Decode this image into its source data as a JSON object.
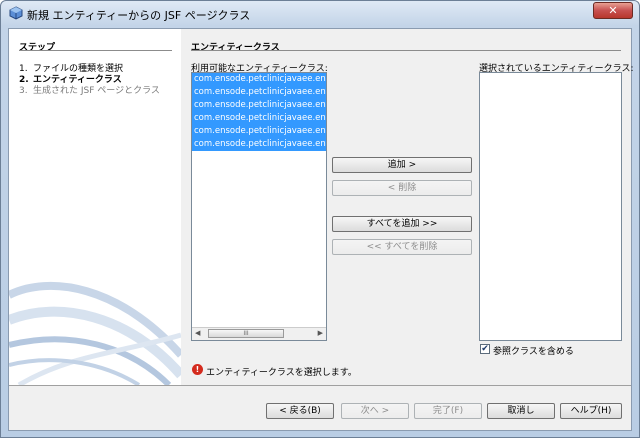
{
  "window": {
    "title": "新規 エンティティーからの JSF ページクラス",
    "close_label": "✕"
  },
  "steps": {
    "title": "ステップ",
    "items": [
      {
        "num": "1.",
        "label": "ファイルの種類を選択"
      },
      {
        "num": "2.",
        "label": "エンティティークラス"
      },
      {
        "num": "3.",
        "label": "生成された JSF ページとクラス"
      }
    ]
  },
  "panel": {
    "title": "エンティティークラス",
    "available_label": "利用可能なエンティティークラス:",
    "selected_label": "選択されているエンティティークラス:",
    "available_items": [
      "com.ensode.petclinicjavaee.ent",
      "com.ensode.petclinicjavaee.ent",
      "com.ensode.petclinicjavaee.ent",
      "com.ensode.petclinicjavaee.ent",
      "com.ensode.petclinicjavaee.ent",
      "com.ensode.petclinicjavaee.ent"
    ],
    "scroll_thumb": "III",
    "add_label": "追加 >",
    "remove_label": "< 削除",
    "add_all_label": "すべてを追加 >>",
    "remove_all_label": "<< すべてを削除",
    "include_ref_label": "参照クラスを含める",
    "include_ref_checked": true,
    "error_message": "エンティティークラスを選択します。"
  },
  "footer": {
    "back_label": "< 戻る(B)",
    "next_label": "次へ >",
    "finish_label": "完了(F)",
    "cancel_label": "取消し",
    "help_label": "ヘルプ(H)"
  }
}
